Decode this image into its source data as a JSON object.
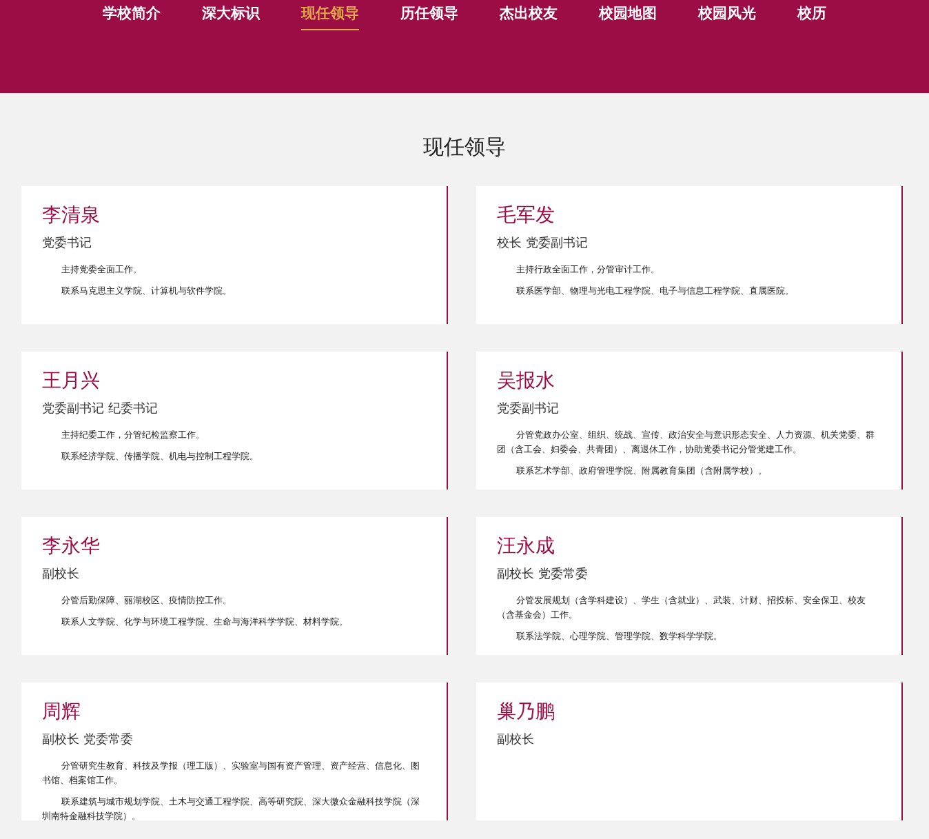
{
  "nav": [
    {
      "label": "学校简介",
      "selected": false
    },
    {
      "label": "深大标识",
      "selected": false
    },
    {
      "label": "现任领导",
      "selected": true
    },
    {
      "label": "历任领导",
      "selected": false
    },
    {
      "label": "杰出校友",
      "selected": false
    },
    {
      "label": "校园地图",
      "selected": false
    },
    {
      "label": "校园风光",
      "selected": false
    },
    {
      "label": "校历",
      "selected": false
    }
  ],
  "title": "现任领导",
  "leaders": [
    {
      "name": "李清泉",
      "position": "党委书记",
      "duties": [
        "主持党委全面工作。",
        "联系马克思主义学院、计算机与软件学院。"
      ]
    },
    {
      "name": "毛军发",
      "position": "校长 党委副书记",
      "duties": [
        "主持行政全面工作，分管审计工作。",
        "联系医学部、物理与光电工程学院、电子与信息工程学院、直属医院。"
      ]
    },
    {
      "name": "王月兴",
      "position": "党委副书记 纪委书记",
      "duties": [
        "主持纪委工作，分管纪检监察工作。",
        "联系经济学院、传播学院、机电与控制工程学院。"
      ]
    },
    {
      "name": "吴报水",
      "position": "党委副书记",
      "duties": [
        "分管党政办公室、组织、统战、宣传、政治安全与意识形态安全、人力资源、机关党委、群团（含工会、妇委会、共青团）、离退休工作，协助党委书记分管党建工作。",
        "联系艺术学部、政府管理学院、附属教育集团（含附属学校）。"
      ]
    },
    {
      "name": "李永华",
      "position": "副校长",
      "duties": [
        "分管后勤保障、丽湖校区、疫情防控工作。",
        "联系人文学院、化学与环境工程学院、生命与海洋科学学院、材料学院。"
      ]
    },
    {
      "name": "汪永成",
      "position": "副校长 党委常委",
      "duties": [
        "分管发展规划（含学科建设）、学生（含就业）、武装、计财、招投标、安全保卫、校友（含基金会）工作。",
        "联系法学院、心理学院、管理学院、数学科学学院。"
      ]
    },
    {
      "name": "周辉",
      "position": "副校长 党委常委",
      "duties": [
        "分管研究生教育、科技及学报（理工版）、实验室与国有资产管理、资产经营、信息化、图书馆、档案馆工作。",
        "联系建筑与城市规划学院、土木与交通工程学院、高等研究院、深大微众金融科技学院（深圳南特金融科技学院）。"
      ]
    },
    {
      "name": "巢乃鹏",
      "position": "副校长"
    }
  ]
}
